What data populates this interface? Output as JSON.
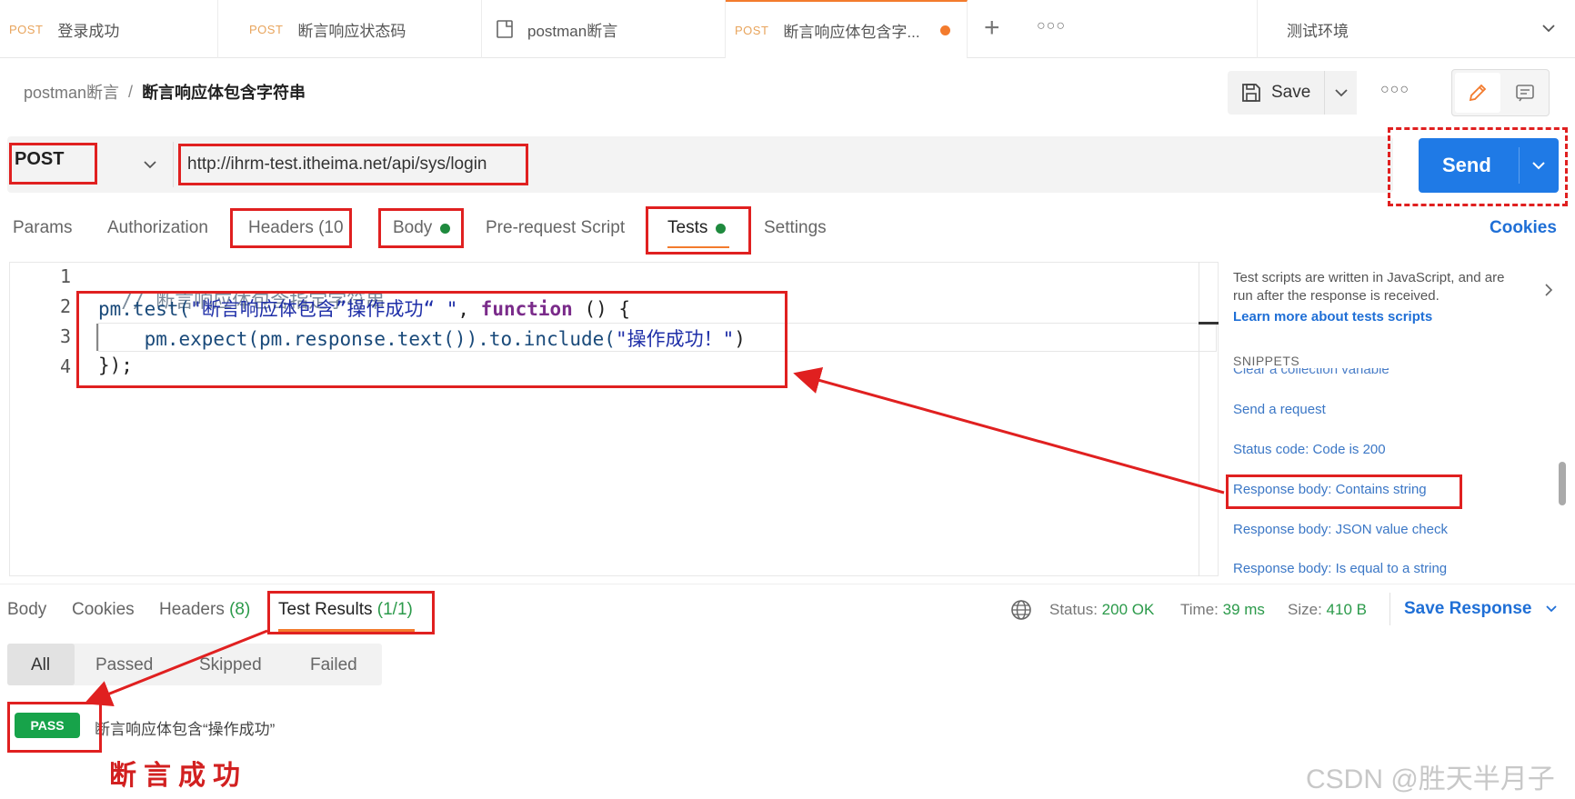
{
  "tabs": [
    {
      "method": "POST",
      "name": "登录成功"
    },
    {
      "method": "POST",
      "name": "断言响应状态码"
    },
    {
      "method": "",
      "name": "postman断言"
    },
    {
      "method": "POST",
      "name": "断言响应体包含字..."
    }
  ],
  "environment": "测试环境",
  "breadcrumb": {
    "collection": "postman断言",
    "separator": "/",
    "request": "断言响应体包含字符串"
  },
  "toolbar": {
    "save_label": "Save"
  },
  "request": {
    "method": "POST",
    "url": "http://ihrm-test.itheima.net/api/sys/login",
    "send_label": "Send"
  },
  "request_tabs": {
    "params": "Params",
    "authorization": "Authorization",
    "headers": "Headers (10",
    "body": "Body",
    "prerequest": "Pre-request Script",
    "tests": "Tests",
    "settings": "Settings",
    "cookies": "Cookies"
  },
  "editor": {
    "line_numbers": [
      "1",
      "2",
      "3",
      "4"
    ],
    "line1_comment": "// 断言响应体包含指定字符串",
    "line2_a": "pm.test(",
    "line2_str": "\"断言响应体包含”操作成功“ \"",
    "line2_b": ", ",
    "line2_kw": "function",
    "line2_c": " () {",
    "line3_a": "    pm.expect(pm.response.text()).to.include(",
    "line3_str": "\"操作成功！\"",
    "line3_b": ")",
    "line4": "});"
  },
  "snippets": {
    "description": "Test scripts are written in JavaScript, and are run after the response is received.",
    "learn_more": "Learn more about tests scripts",
    "heading": "SNIPPETS",
    "clipped_item": "Clear a collection variable",
    "items": [
      "Send a request",
      "Status code: Code is 200",
      "Response body: Contains string",
      "Response body: JSON value check",
      "Response body: Is equal to a string"
    ]
  },
  "response": {
    "tab_body": "Body",
    "tab_cookies": "Cookies",
    "tab_headers": "Headers",
    "headers_count": "(8)",
    "tab_test_results": "Test Results",
    "test_results_count": "(1/1)",
    "status_label": "Status:",
    "status_value": "200 OK",
    "time_label": "Time:",
    "time_value": "39 ms",
    "size_label": "Size:",
    "size_value": "410 B",
    "save_response": "Save Response"
  },
  "filters": [
    "All",
    "Passed",
    "Skipped",
    "Failed"
  ],
  "result": {
    "badge": "PASS",
    "text": "断言响应体包含“操作成功”"
  },
  "annotation_note": "断言成功",
  "watermark": "CSDN @胜天半月子",
  "colors": {
    "accent_orange": "#f37b2d",
    "send_blue": "#1f7ae6",
    "pass_green": "#17a34a",
    "annotation_red": "#e02020"
  }
}
